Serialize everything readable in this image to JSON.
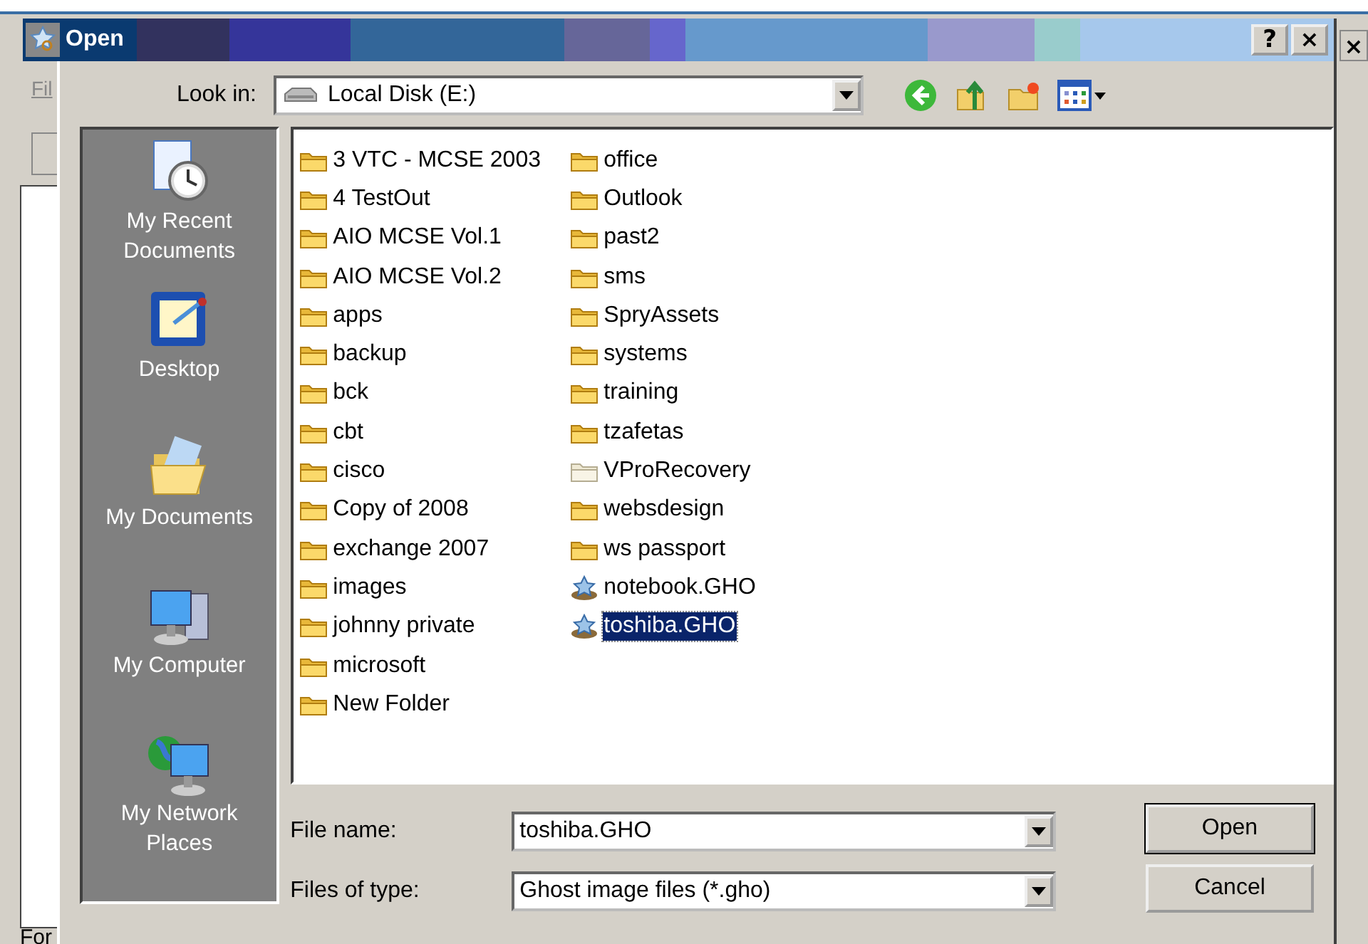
{
  "background_window": {
    "menu_label": "Fil",
    "status_text": "For"
  },
  "window": {
    "title": "Open",
    "buttons": [
      {
        "kind": "help",
        "label": "?"
      },
      {
        "kind": "close",
        "label": "×"
      }
    ],
    "outer_close": "×"
  },
  "look_in": {
    "label": "Look in:",
    "value": "Local Disk (E:)"
  },
  "places": [
    {
      "kind": "recent",
      "label": "My Recent Documents"
    },
    {
      "kind": "desktop",
      "label": "Desktop"
    },
    {
      "kind": "documents",
      "label": "My Documents"
    },
    {
      "kind": "computer",
      "label": "My Computer"
    },
    {
      "kind": "network",
      "label": "My Network Places"
    }
  ],
  "files": [
    {
      "name": "3 VTC - MCSE 2003",
      "kind": "folder",
      "selected": false
    },
    {
      "name": "4 TestOut",
      "kind": "folder",
      "selected": false
    },
    {
      "name": "AIO MCSE Vol.1",
      "kind": "folder",
      "selected": false
    },
    {
      "name": "AIO MCSE Vol.2",
      "kind": "folder",
      "selected": false
    },
    {
      "name": "apps",
      "kind": "folder",
      "selected": false
    },
    {
      "name": "backup",
      "kind": "folder",
      "selected": false
    },
    {
      "name": "bck",
      "kind": "folder",
      "selected": false
    },
    {
      "name": "cbt",
      "kind": "folder",
      "selected": false
    },
    {
      "name": "cisco",
      "kind": "folder",
      "selected": false
    },
    {
      "name": "Copy of 2008",
      "kind": "folder",
      "selected": false
    },
    {
      "name": "exchange 2007",
      "kind": "folder",
      "selected": false
    },
    {
      "name": "images",
      "kind": "folder",
      "selected": false
    },
    {
      "name": "johnny private",
      "kind": "folder",
      "selected": false
    },
    {
      "name": "microsoft",
      "kind": "folder",
      "selected": false
    },
    {
      "name": "New Folder",
      "kind": "folder",
      "selected": false
    },
    {
      "name": "office",
      "kind": "folder",
      "selected": false
    },
    {
      "name": "Outlook",
      "kind": "folder",
      "selected": false
    },
    {
      "name": "past2",
      "kind": "folder",
      "selected": false
    },
    {
      "name": "sms",
      "kind": "folder",
      "selected": false
    },
    {
      "name": "SpryAssets",
      "kind": "folder",
      "selected": false
    },
    {
      "name": "systems",
      "kind": "folder",
      "selected": false
    },
    {
      "name": "training",
      "kind": "folder",
      "selected": false
    },
    {
      "name": "tzafetas",
      "kind": "folder",
      "selected": false
    },
    {
      "name": "VProRecovery",
      "kind": "hidden-folder",
      "selected": false
    },
    {
      "name": "websdesign",
      "kind": "folder",
      "selected": false
    },
    {
      "name": "ws passport",
      "kind": "folder",
      "selected": false
    },
    {
      "name": "notebook.GHO",
      "kind": "ghost-image",
      "selected": false
    },
    {
      "name": "toshiba.GHO",
      "kind": "ghost-image",
      "selected": true
    }
  ],
  "file_name": {
    "label": "File name:",
    "value": "toshiba.GHO"
  },
  "file_type": {
    "label": "Files of type:",
    "value": "Ghost image files (*.gho)"
  },
  "buttons": [
    {
      "label": "Open",
      "default": true
    },
    {
      "label": "Cancel",
      "default": false
    }
  ]
}
